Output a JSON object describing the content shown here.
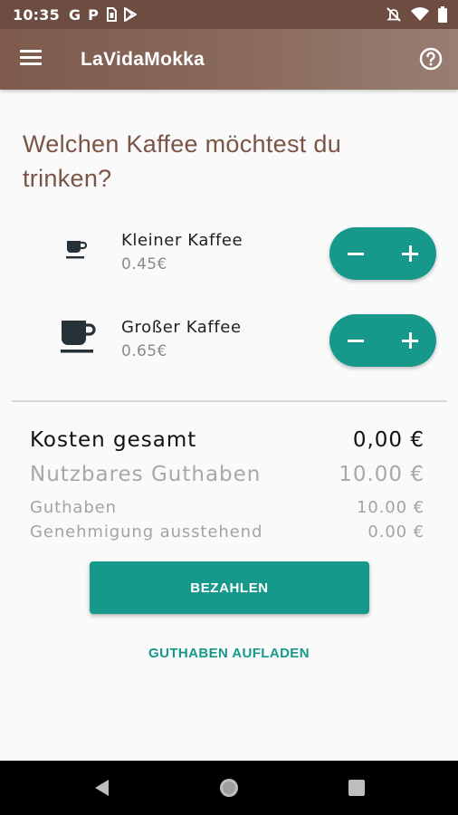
{
  "status_bar": {
    "time": "10:35",
    "notifications": [
      "G",
      "P"
    ],
    "icons": [
      "sim-card-icon",
      "play-store-icon",
      "do-not-disturb-icon",
      "wifi-icon",
      "battery-icon"
    ]
  },
  "app_bar": {
    "title": "LaVidaMokka",
    "menu_icon": "hamburger-menu-icon",
    "help_icon": "help-circle-icon",
    "color": "#7d5a4c"
  },
  "heading": "Welchen Kaffee möchtest du trinken?",
  "products": [
    {
      "name": "Kleiner Kaffee",
      "price": "0.45€",
      "icon": "small-coffee-cup-icon"
    },
    {
      "name": "Großer Kaffee",
      "price": "0.65€",
      "icon": "large-coffee-cup-icon"
    }
  ],
  "summary": {
    "total_label": "Kosten gesamt",
    "total_value": "0,00 €",
    "usable_label": "Nutzbares Guthaben",
    "usable_value": "10.00 €",
    "credit_label": "Guthaben",
    "credit_value": "10.00 €",
    "pending_label": "Genehmigung ausstehend",
    "pending_value": "0.00 €"
  },
  "actions": {
    "pay_label": "BEZAHLEN",
    "topup_label": "GUTHABEN AUFLADEN"
  },
  "colors": {
    "accent": "#16998a",
    "brown": "#7a5546"
  },
  "nav_bar": {
    "icons": [
      "back-icon",
      "home-icon",
      "recents-icon"
    ]
  }
}
